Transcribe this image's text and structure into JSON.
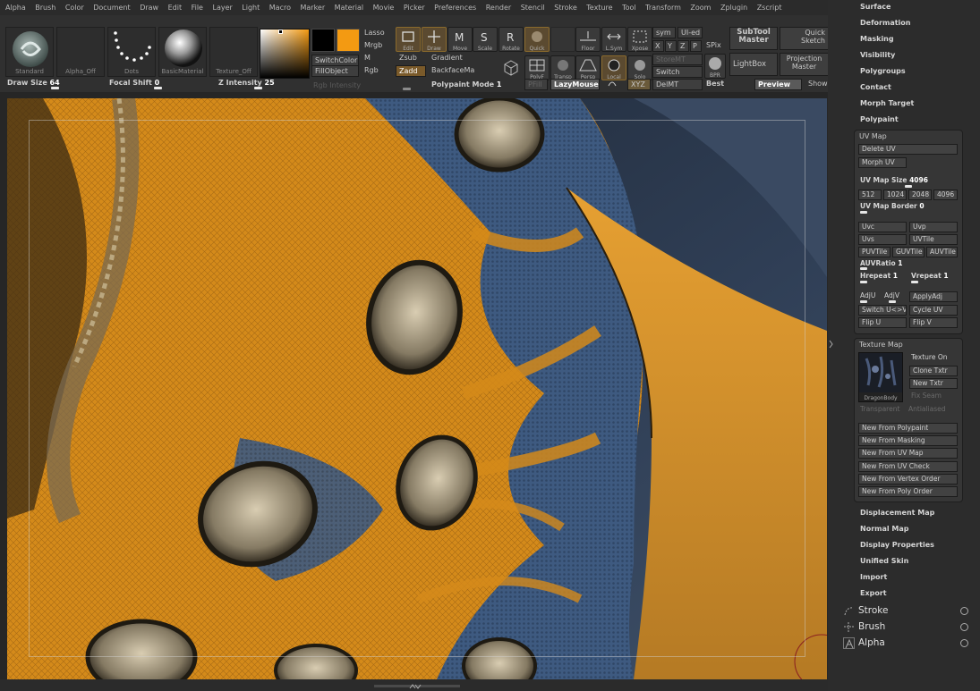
{
  "menu": [
    "Alpha",
    "Brush",
    "Color",
    "Document",
    "Draw",
    "Edit",
    "File",
    "Layer",
    "Light",
    "Macro",
    "Marker",
    "Material",
    "Movie",
    "Picker",
    "Preferences",
    "Render",
    "Stencil",
    "Stroke",
    "Texture",
    "Tool",
    "Transform",
    "Zoom",
    "Zplugin",
    "Zscript"
  ],
  "shelf": {
    "thumbs": [
      "Standard",
      "Alpha_Off",
      "Dots",
      "BasicMaterial",
      "Texture_Off"
    ],
    "draw_size_label": "Draw Size",
    "draw_size": "64",
    "focal_shift_label": "Focal Shift",
    "focal_shift": "0",
    "z_intensity_label": "Z Intensity",
    "z_intensity": "25",
    "rgb_intensity_label": "Rgb Intensity",
    "colors": {
      "main": "#f39a12",
      "secondary": "#000000"
    },
    "switch_color": "SwitchColor",
    "fill_object": "FillObject",
    "lasso": "Lasso",
    "mrgb": "Mrgb",
    "m": "M",
    "rgb": "Rgb",
    "zsub": "Zsub",
    "zadd": "Zadd",
    "gradient": "Gradient",
    "backface": "BackfaceMa",
    "polypaint_mode_label": "Polypaint Mode",
    "polypaint_mode": "1",
    "tools": [
      "Edit",
      "Draw",
      "Move",
      "Scale",
      "Rotate",
      "Quick",
      "",
      "Floor",
      "L.Sym",
      "Xpose"
    ],
    "view_tools": [
      "PolyF",
      "Transp",
      "Persp",
      "Local",
      "Solo"
    ],
    "lazymouse": "LazyMouse",
    "sym": "sym",
    "ui_ed": "UI-ed",
    "xyz": [
      "X",
      "Y",
      "Z",
      "P"
    ],
    "spix": "SPix",
    "storemt": "StoreMT",
    "switch": "Switch",
    "delmt": "DelMT",
    "bpr": "BPR",
    "best": "Best",
    "subtool_master": "SubTool Master",
    "quick_sketch": "Quick Sketch",
    "lightbox": "LightBox",
    "projection_master": "Projection Master",
    "preview": "Preview",
    "show": "Show",
    "xyz_toggle": "XYZ",
    "pfill": "PFill"
  },
  "tray": {
    "top_sections": [
      "Surface",
      "Deformation",
      "Masking",
      "Visibility",
      "Polygroups",
      "Contact",
      "Morph Target",
      "Polypaint"
    ],
    "uv_map": {
      "title": "UV Map",
      "delete_uv": "Delete UV",
      "morph_uv": "Morph UV",
      "size_label": "UV Map Size",
      "size": "4096",
      "sizes": [
        "512",
        "1024",
        "2048",
        "4096"
      ],
      "border_label": "UV Map Border",
      "border": "0",
      "buttons_a": [
        "Uvc",
        "Uvp",
        "Uvs",
        "UVTile"
      ],
      "buttons_b": [
        "PUVTile",
        "GUVTile",
        "AUVTile"
      ],
      "auvratio_label": "AUVRatio",
      "auvratio": "1",
      "hrepeat_label": "Hrepeat",
      "hrepeat": "1",
      "vrepeat_label": "Vrepeat",
      "vrepeat": "1",
      "adju": "AdjU",
      "adjv": "AdjV",
      "applyadj": "ApplyAdj",
      "switch_uv": "Switch U<>V",
      "cycle_uv": "Cycle UV",
      "flip_u": "Flip U",
      "flip_v": "Flip V"
    },
    "texture_map": {
      "title": "Texture Map",
      "texture_name": "DragonBody",
      "texture_on": "Texture On",
      "clone_txtr": "Clone Txtr",
      "new_txtr": "New Txtr",
      "fix_seam": "Fix Seam",
      "transparent": "Transparent",
      "antialiased": "Antialiased",
      "new_from": [
        "New From Polypaint",
        "New From Masking",
        "New From UV Map",
        "New From UV Check",
        "New From Vertex Order",
        "New From Poly Order"
      ]
    },
    "bottom_sections": [
      "Displacement Map",
      "Normal Map",
      "Display Properties",
      "Unified Skin",
      "Import",
      "Export"
    ],
    "palettes": [
      "Stroke",
      "Brush",
      "Alpha"
    ]
  }
}
